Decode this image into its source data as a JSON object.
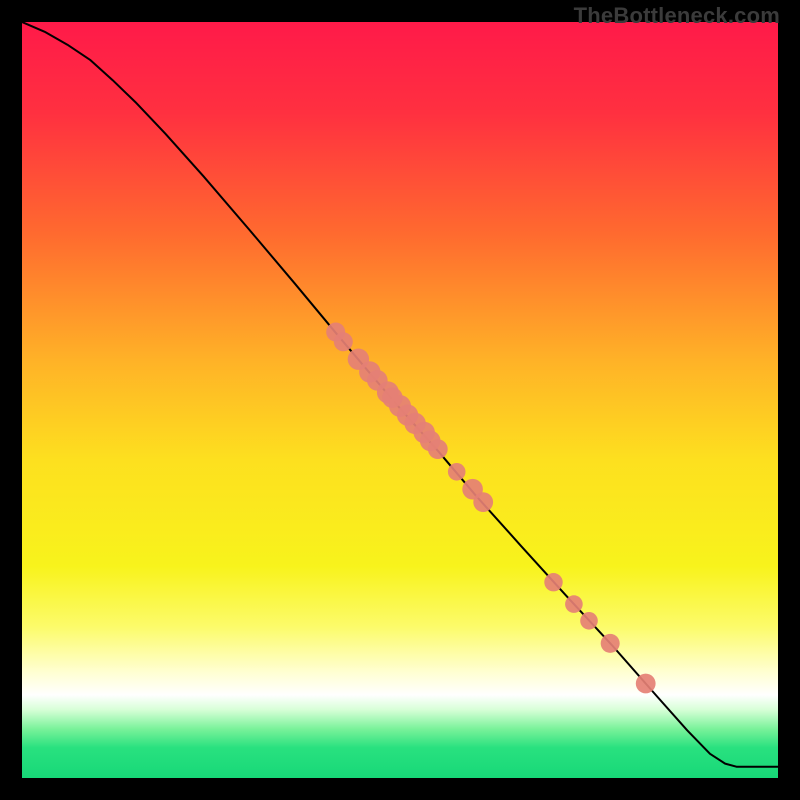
{
  "watermark": "TheBottleneck.com",
  "chart_data": {
    "type": "line",
    "title": "",
    "xlabel": "",
    "ylabel": "",
    "xlim": [
      0,
      100
    ],
    "ylim": [
      0,
      100
    ],
    "gradient_stops": [
      {
        "offset": 0,
        "color": "#ff1a49"
      },
      {
        "offset": 12,
        "color": "#ff3040"
      },
      {
        "offset": 28,
        "color": "#ff6a2f"
      },
      {
        "offset": 45,
        "color": "#ffb327"
      },
      {
        "offset": 58,
        "color": "#fde01f"
      },
      {
        "offset": 72,
        "color": "#f8f31c"
      },
      {
        "offset": 80,
        "color": "#fcfb6a"
      },
      {
        "offset": 86,
        "color": "#ffffd2"
      },
      {
        "offset": 89,
        "color": "#ffffff"
      },
      {
        "offset": 91,
        "color": "#d6ffd6"
      },
      {
        "offset": 93.5,
        "color": "#7af29a"
      },
      {
        "offset": 96,
        "color": "#29e17f"
      },
      {
        "offset": 100,
        "color": "#17d878"
      }
    ],
    "line": [
      {
        "x": 0.0,
        "y": 100.0
      },
      {
        "x": 3.0,
        "y": 98.7
      },
      {
        "x": 6.0,
        "y": 97.0
      },
      {
        "x": 9.0,
        "y": 95.0
      },
      {
        "x": 12.0,
        "y": 92.3
      },
      {
        "x": 15.0,
        "y": 89.4
      },
      {
        "x": 19.0,
        "y": 85.2
      },
      {
        "x": 24.0,
        "y": 79.6
      },
      {
        "x": 30.0,
        "y": 72.6
      },
      {
        "x": 36.0,
        "y": 65.5
      },
      {
        "x": 42.0,
        "y": 58.3
      },
      {
        "x": 47.0,
        "y": 52.4
      },
      {
        "x": 50.0,
        "y": 48.9
      },
      {
        "x": 55.0,
        "y": 43.3
      },
      {
        "x": 60.0,
        "y": 37.4
      },
      {
        "x": 66.0,
        "y": 30.7
      },
      {
        "x": 72.0,
        "y": 24.1
      },
      {
        "x": 78.0,
        "y": 17.6
      },
      {
        "x": 84.0,
        "y": 10.8
      },
      {
        "x": 88.0,
        "y": 6.3
      },
      {
        "x": 91.0,
        "y": 3.2
      },
      {
        "x": 93.0,
        "y": 1.9
      },
      {
        "x": 94.5,
        "y": 1.5
      },
      {
        "x": 100.0,
        "y": 1.5
      }
    ],
    "points": [
      {
        "x": 41.5,
        "y": 59.0,
        "r": 1.2
      },
      {
        "x": 42.5,
        "y": 57.7,
        "r": 1.2
      },
      {
        "x": 44.5,
        "y": 55.4,
        "r": 1.5
      },
      {
        "x": 46.0,
        "y": 53.7,
        "r": 1.5
      },
      {
        "x": 47.0,
        "y": 52.6,
        "r": 1.4
      },
      {
        "x": 48.4,
        "y": 51.0,
        "r": 1.6
      },
      {
        "x": 49.0,
        "y": 50.3,
        "r": 1.4
      },
      {
        "x": 50.0,
        "y": 49.2,
        "r": 1.6
      },
      {
        "x": 51.0,
        "y": 48.0,
        "r": 1.5
      },
      {
        "x": 52.0,
        "y": 46.9,
        "r": 1.5
      },
      {
        "x": 53.2,
        "y": 45.7,
        "r": 1.5
      },
      {
        "x": 54.0,
        "y": 44.6,
        "r": 1.4
      },
      {
        "x": 55.0,
        "y": 43.5,
        "r": 1.3
      },
      {
        "x": 57.5,
        "y": 40.5,
        "r": 1.0
      },
      {
        "x": 59.6,
        "y": 38.2,
        "r": 1.4
      },
      {
        "x": 61.0,
        "y": 36.5,
        "r": 1.3
      },
      {
        "x": 70.3,
        "y": 25.9,
        "r": 1.1
      },
      {
        "x": 73.0,
        "y": 23.0,
        "r": 1.0
      },
      {
        "x": 75.0,
        "y": 20.8,
        "r": 1.0
      },
      {
        "x": 77.8,
        "y": 17.8,
        "r": 1.2
      },
      {
        "x": 82.5,
        "y": 12.5,
        "r": 1.3
      }
    ],
    "point_color": "#e58075",
    "line_stroke": "#000000",
    "line_width": 2
  }
}
